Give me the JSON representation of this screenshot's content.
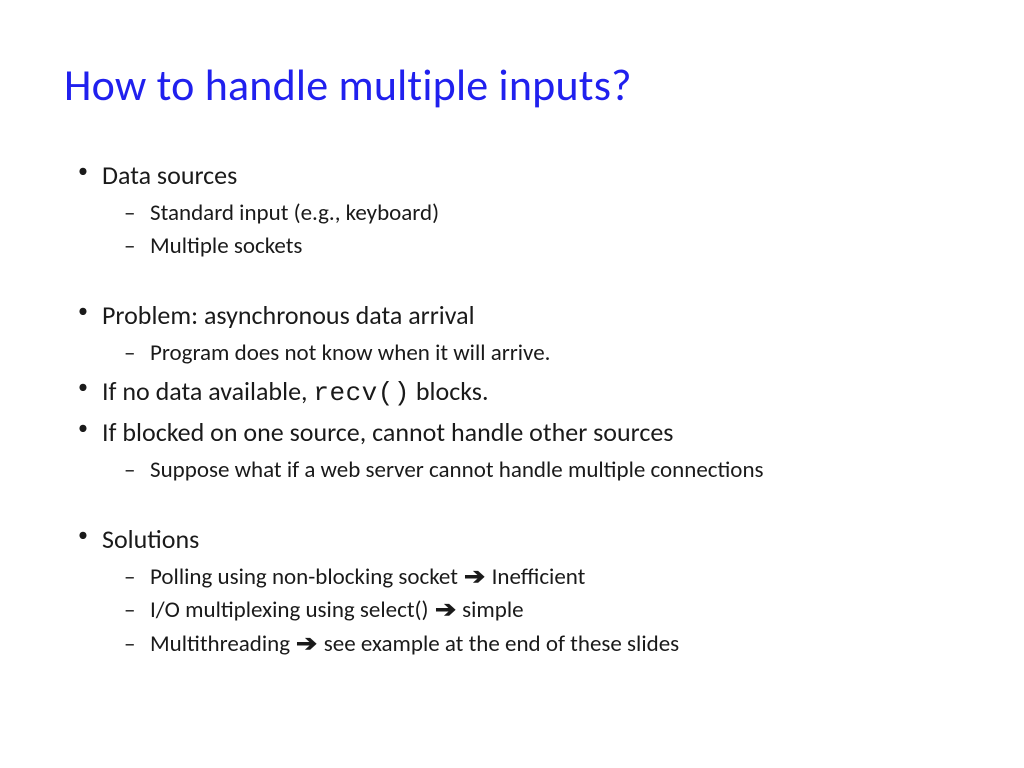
{
  "title": "How to handle multiple inputs?",
  "bullets": [
    {
      "text": "Data sources",
      "sub": [
        "Standard input (e.g., keyboard)",
        "Multiple sockets"
      ]
    },
    {
      "spacer": true
    },
    {
      "text": "Problem: asynchronous data arrival",
      "sub": [
        "Program does not know when it will arrive."
      ]
    },
    {
      "html": true,
      "parts": [
        "If no data available, ",
        "recv()",
        " blocks."
      ]
    },
    {
      "text": "If blocked on one source, cannot handle other sources",
      "sub": [
        "Suppose what if a web server cannot handle multiple connections"
      ]
    },
    {
      "spacer": true
    },
    {
      "text": "Solutions",
      "sub_arrow": [
        {
          "pre": "Polling using non-blocking socket ",
          "post": " Inefficient"
        },
        {
          "pre": "I/O multiplexing using select() ",
          "post": " simple"
        },
        {
          "pre": "Multithreading ",
          "post": " see example at the end of these slides"
        }
      ]
    }
  ],
  "arrow_glyph": "➔"
}
